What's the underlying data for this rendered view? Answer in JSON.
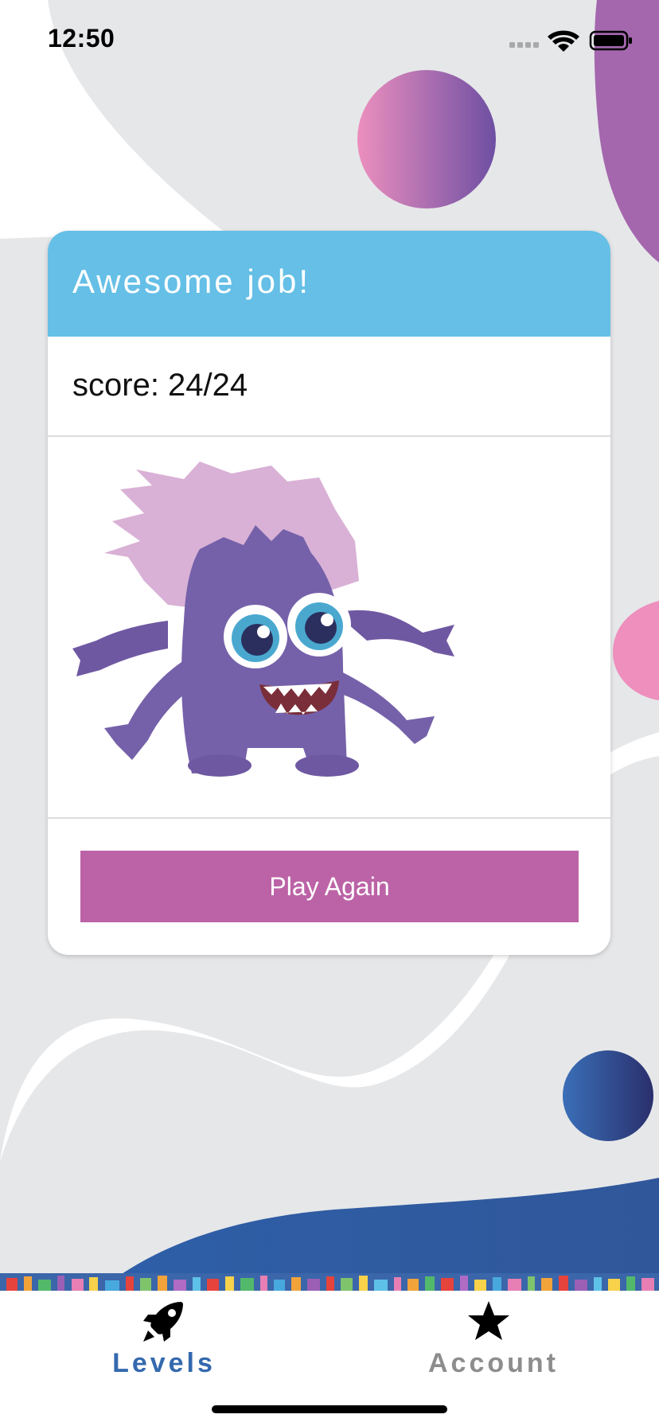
{
  "status_bar": {
    "time": "12:50"
  },
  "card": {
    "title": "Awesome job!",
    "score_text": "score: 24/24",
    "play_again_label": "Play Again",
    "header_color": "#65bfe6",
    "button_color": "#bc63a7"
  },
  "tabs": [
    {
      "label": "Levels",
      "icon": "rocket-icon",
      "active": true,
      "color": "#3469ae"
    },
    {
      "label": "Account",
      "icon": "star-icon",
      "active": false,
      "color": "#8d8d8d"
    }
  ],
  "colors": {
    "background_blob": "#e6e7e9",
    "wave_blue": "#2f5c9d",
    "planet_pink_purple": "#a066ad",
    "planet_navy": "#2c4a8d"
  }
}
